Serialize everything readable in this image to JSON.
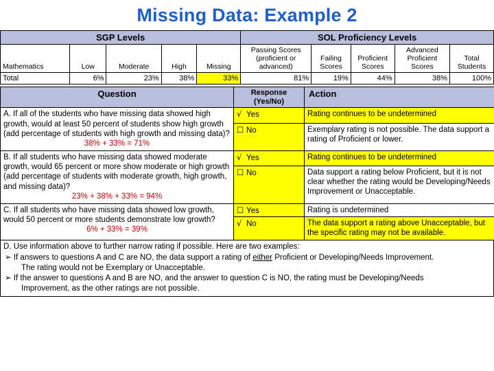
{
  "title": "Missing Data: Example 2",
  "top_table": {
    "group_headers": {
      "sgp": "SGP Levels",
      "sol": "SOL Proficiency Levels"
    },
    "columns": [
      "Mathematics",
      "Low",
      "Moderate",
      "High",
      "Missing",
      "Passing Scores (proficient or advanced)",
      "Failing Scores",
      "Proficient Scores",
      "Advanced Proficient Scores",
      "Total Students"
    ],
    "column_lines": {
      "passing": [
        "Passing Scores",
        "(proficient or",
        "advanced)"
      ],
      "failing": [
        "Failing",
        "Scores"
      ],
      "proficient": [
        "Proficient",
        "Scores"
      ],
      "advanced": [
        "Advanced",
        "Proficient",
        "Scores"
      ],
      "total": [
        "Total",
        "Students"
      ]
    },
    "rows": [
      {
        "label": "Total",
        "low": "6%",
        "moderate": "23%",
        "high": "38%",
        "missing": "33%",
        "passing": "81%",
        "failing": "19%",
        "proficient": "44%",
        "advanced": "38%",
        "total": "100%"
      }
    ]
  },
  "question_table": {
    "headers": {
      "question": "Question",
      "response": "Response (Yes/No)",
      "response_line1": "Response",
      "response_line2": "(Yes/No)",
      "action": "Action"
    },
    "rows": [
      {
        "id": "A",
        "question_text": "A. If all of the students who have missing data showed high growth, would at least 50 percent of students show high growth (add percentage of students with high growth and missing data)?",
        "math": "38% + 33% = 71%",
        "responses": [
          {
            "mark": "√",
            "label": "Yes",
            "action": "Rating continues to be undetermined",
            "action_highlight": true
          },
          {
            "mark": "☐",
            "label": "No",
            "action": "Exemplary rating is not possible.  The data support a rating of Proficient or lower.",
            "action_highlight": false
          }
        ]
      },
      {
        "id": "B",
        "question_text": "B. If all students who have missing data showed moderate growth, would 65 percent or more show moderate or high growth (add percentage of students with moderate growth, high growth, and missing data)?",
        "math": "23% + 38% + 33% =  94%",
        "responses": [
          {
            "mark": "√",
            "label": "Yes",
            "action": "Rating continues to be undetermined",
            "action_highlight": true
          },
          {
            "mark": "☐",
            "label": "No",
            "action": "Data support a rating below Proficient, but it is not clear whether the rating would be Developing/Needs Improvement or Unacceptable.",
            "action_highlight": false
          }
        ]
      },
      {
        "id": "C",
        "question_text": "C. If all students who have missing data showed low growth, would 50 percent or more students demonstrate low growth?",
        "math": "6% + 33% = 39%",
        "responses": [
          {
            "mark": "☐",
            "label": "Yes",
            "action": "Rating is undetermined",
            "action_highlight": false
          },
          {
            "mark": "√",
            "label": "No",
            "action": "The data support a rating above Unacceptable, but the specific rating may not be available.",
            "action_highlight": true
          }
        ]
      }
    ]
  },
  "notes": {
    "lead": "D.  Use information above to further narrow rating if possible.  Here are two examples:",
    "bullets": [
      {
        "arrow": "➢",
        "line1_pre": "If answers to questions A and C are NO, the data support a rating of ",
        "line1_underline": "either",
        "line1_post": " Proficient or Developing/Needs Improvement.",
        "line2": "The rating would not be Exemplary or Unacceptable."
      },
      {
        "arrow": "➢",
        "line1": "If the answer to questions A and B are NO, and the answer to question C is NO, the rating must be Developing/Needs",
        "line2": "Improvement, as the other ratings are not possible."
      }
    ]
  }
}
